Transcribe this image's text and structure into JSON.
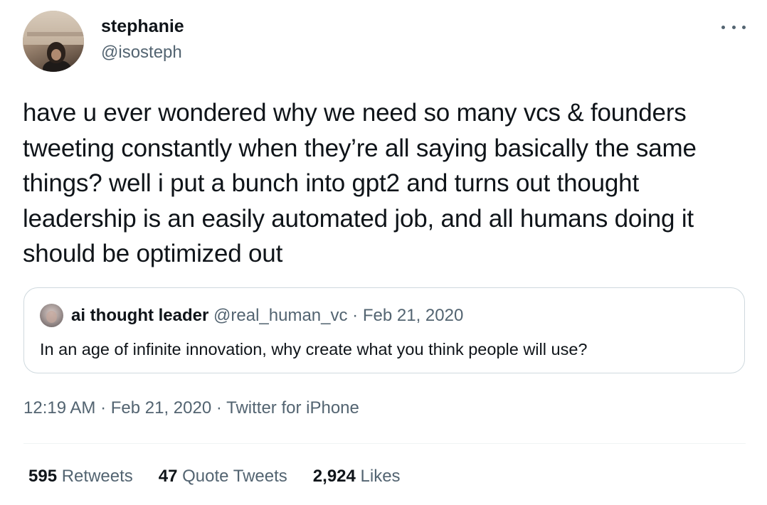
{
  "author": {
    "name": "stephanie",
    "handle": "@isosteph",
    "avatar_icon": "profile-photo"
  },
  "more_icon": "more-horizontal-icon",
  "tweet": {
    "text": "have u ever wondered why we need so many vcs & founders tweeting constantly when they’re all saying basically the same things? well i put a bunch into gpt2 and turns out thought leadership is an easily automated job, and all humans doing it should be optimized out"
  },
  "quote": {
    "name": "ai thought leader",
    "handle": "@real_human_vc",
    "separator": "·",
    "date": "Feb 21, 2020",
    "text": "In an age of infinite innovation, why create what you think people will use?"
  },
  "timestamp": {
    "time": "12:19 AM",
    "separator": "·",
    "date": "Feb 21, 2020",
    "source": "Twitter for iPhone"
  },
  "stats": {
    "retweets_count": "595",
    "retweets_label": "Retweets",
    "quotes_count": "47",
    "quotes_label": "Quote Tweets",
    "likes_count": "2,924",
    "likes_label": "Likes"
  },
  "colors": {
    "text": "#0f1419",
    "secondary": "#536471",
    "border": "#cfd9de"
  }
}
